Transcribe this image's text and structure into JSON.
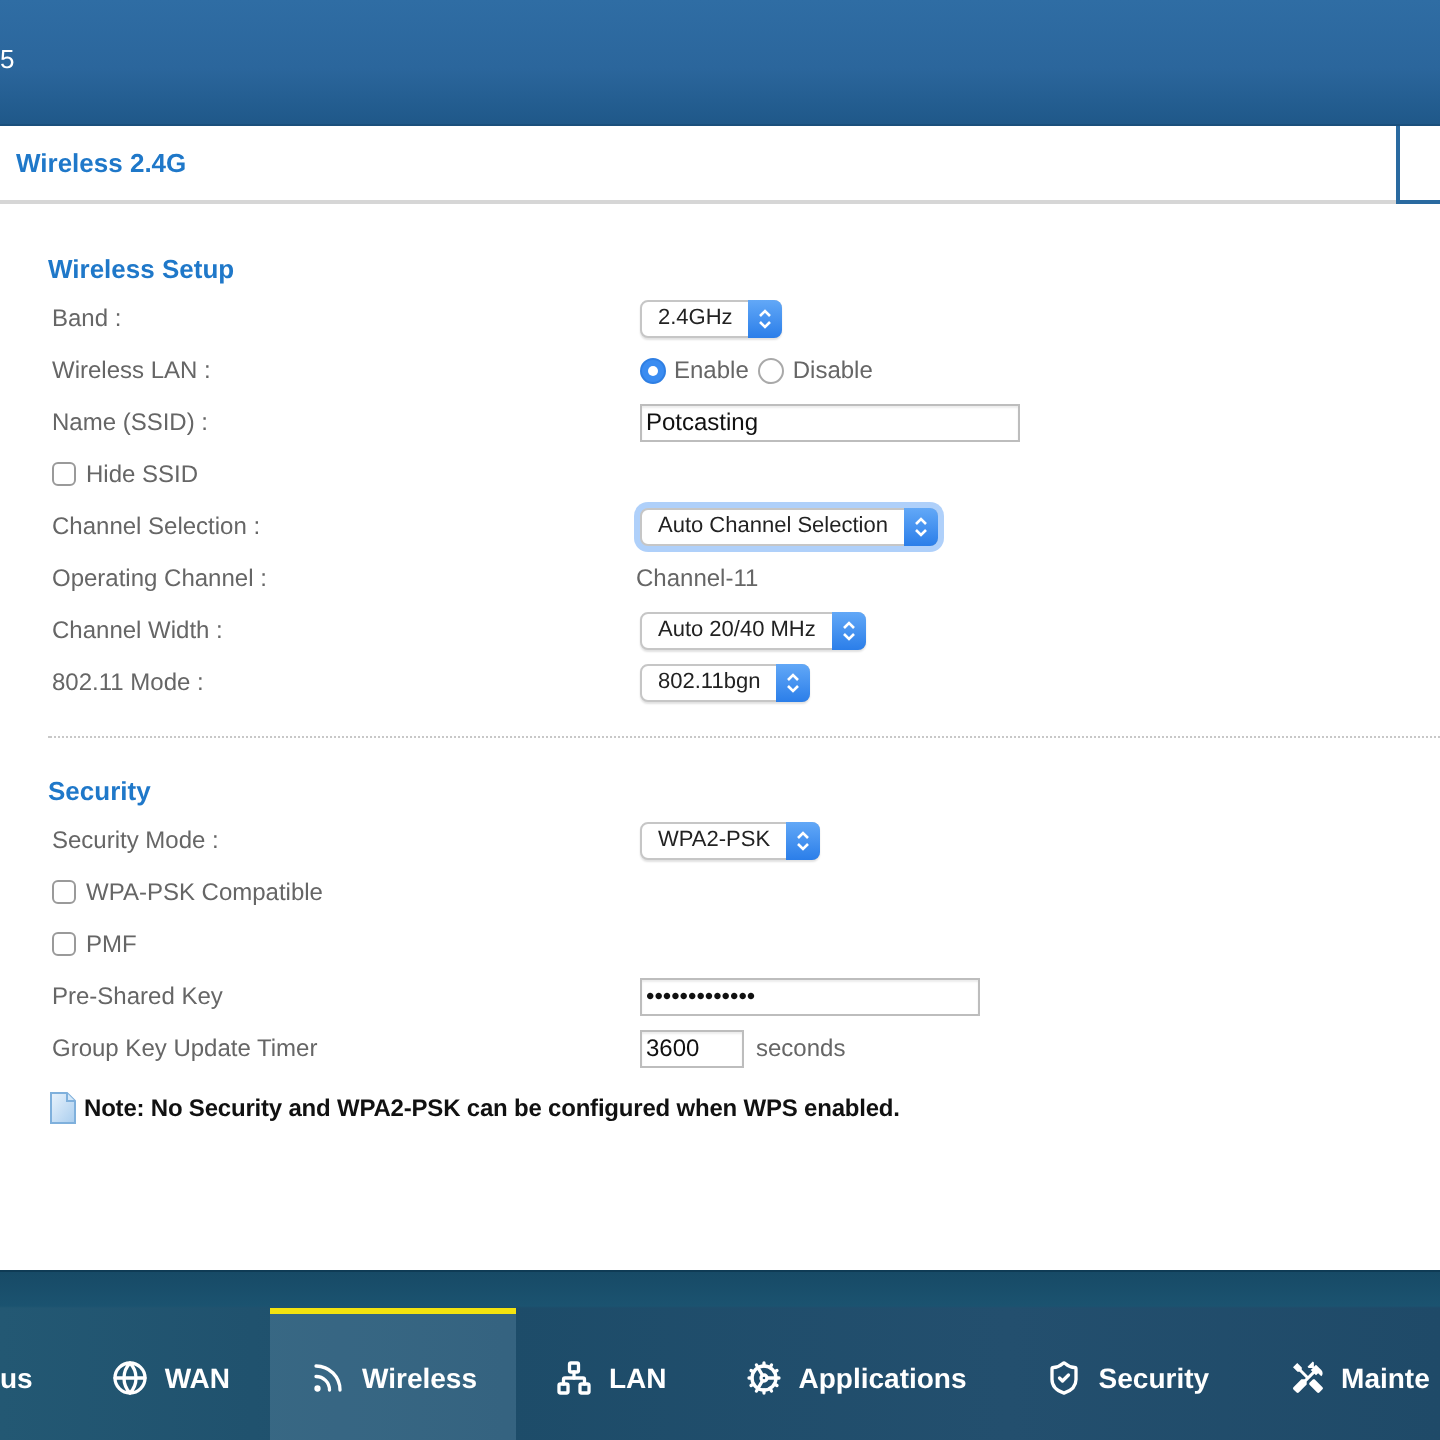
{
  "header": {
    "title": "5"
  },
  "page_title": "Wireless 2.4G",
  "sections": [
    {
      "heading": "Wireless Setup",
      "rows": [
        {
          "kind": "select",
          "label": "Band :",
          "value": "2.4GHz",
          "focused": false
        },
        {
          "kind": "radio",
          "label": "Wireless LAN :",
          "options": [
            {
              "label": "Enable",
              "selected": true
            },
            {
              "label": "Disable",
              "selected": false
            }
          ]
        },
        {
          "kind": "text",
          "label": "Name (SSID) :",
          "value": "Potcasting"
        },
        {
          "kind": "checkbox",
          "label": "Hide SSID",
          "checked": false
        },
        {
          "kind": "select",
          "label": "Channel Selection :",
          "value": "Auto Channel Selection",
          "focused": true
        },
        {
          "kind": "static",
          "label": "Operating Channel :",
          "value": "Channel-11"
        },
        {
          "kind": "select",
          "label": "Channel Width :",
          "value": "Auto 20/40 MHz",
          "focused": false
        },
        {
          "kind": "select",
          "label": "802.11 Mode :",
          "value": "802.11bgn",
          "focused": false
        }
      ]
    },
    {
      "heading": "Security",
      "rows": [
        {
          "kind": "select",
          "label": "Security Mode :",
          "value": "WPA2-PSK",
          "focused": false
        },
        {
          "kind": "checkbox",
          "label": "WPA-PSK Compatible",
          "checked": false
        },
        {
          "kind": "checkbox",
          "label": "PMF",
          "checked": false
        },
        {
          "kind": "password",
          "label": "Pre-Shared Key",
          "value": "•••••••••••••"
        },
        {
          "kind": "number",
          "label": "Group Key Update Timer",
          "value": "3600",
          "unit": "seconds"
        }
      ],
      "note": "Note: No Security and WPA2-PSK can be configured when WPS enabled."
    }
  ],
  "nav": [
    {
      "label": "us",
      "selected": false
    },
    {
      "label": "WAN",
      "selected": false
    },
    {
      "label": "Wireless",
      "selected": true
    },
    {
      "label": "LAN",
      "selected": false
    },
    {
      "label": "Applications",
      "selected": false
    },
    {
      "label": "Security",
      "selected": false
    },
    {
      "label": "Mainte",
      "selected": false
    }
  ]
}
